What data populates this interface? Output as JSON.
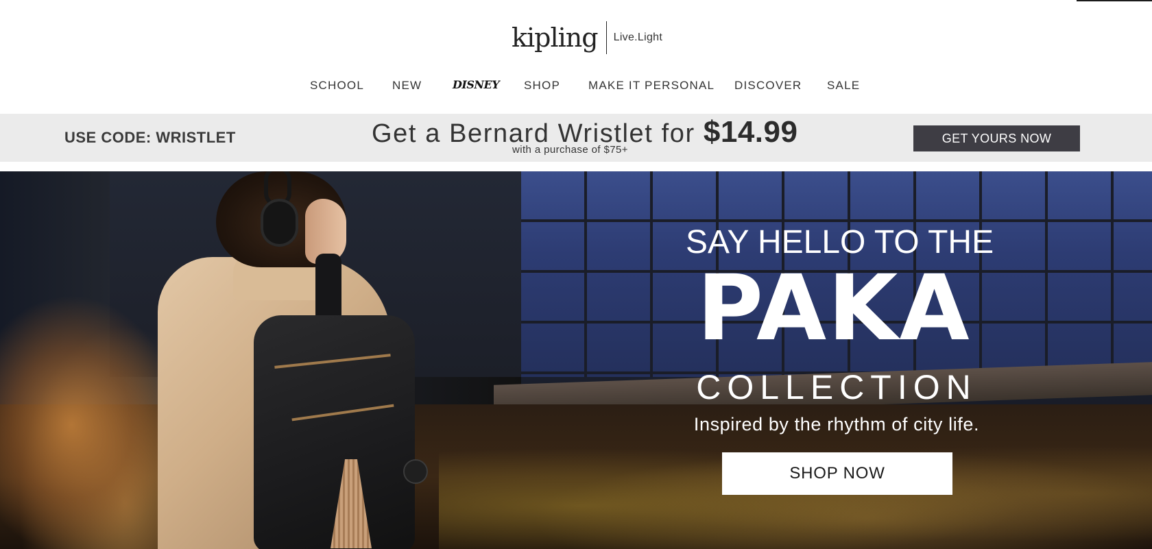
{
  "brand": {
    "logo_text": "kipling",
    "tagline": "Live.Light"
  },
  "nav": {
    "items": [
      {
        "label": "SCHOOL"
      },
      {
        "label": "NEW"
      },
      {
        "label": "Disney"
      },
      {
        "label": "SHOP"
      },
      {
        "label": "MAKE IT PERSONAL"
      },
      {
        "label": "DISCOVER"
      },
      {
        "label": "SALE"
      }
    ]
  },
  "promo": {
    "code_text": "USE CODE: WRISTLET",
    "headline": "Get a Bernard Wristlet for ",
    "price": "$14.99",
    "subline": "with a purchase of $75+",
    "cta_label": "GET YOURS NOW",
    "background_color": "#ebebeb",
    "cta_color": "#3e3d44"
  },
  "hero": {
    "eyebrow": "SAY HELLO TO THE",
    "title": "PAKA",
    "collection": "COLLECTION",
    "tagline": "Inspired by the rhythm of city life.",
    "cta_label": "SHOP NOW",
    "image_description_icon": "woman-with-backpack-photo"
  }
}
